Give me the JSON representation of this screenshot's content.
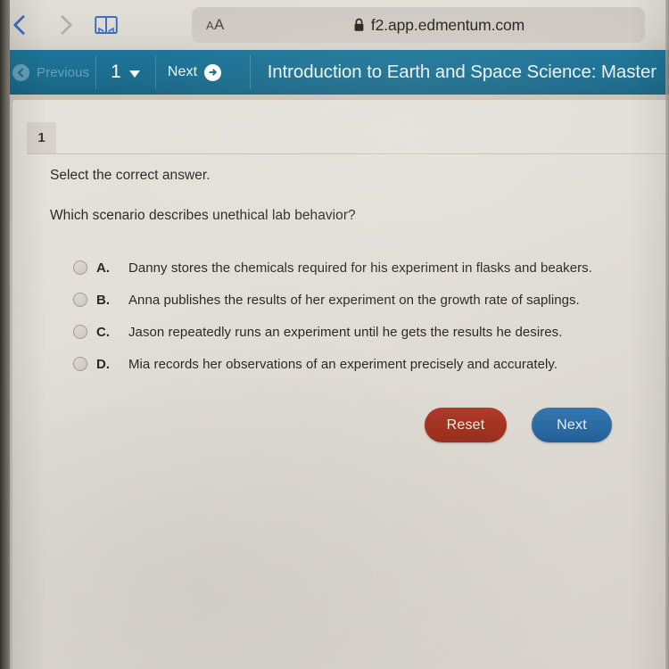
{
  "browser": {
    "back_icon": "chevron-left-icon",
    "forward_icon": "chevron-right-icon",
    "bookmarks_icon": "book-icon",
    "text_size_label": "AA",
    "lock_icon": "lock-icon",
    "url": "f2.app.edmentum.com"
  },
  "navbar": {
    "previous_label": "Previous",
    "previous_icon": "arrow-left-circle-icon",
    "page_number": "1",
    "page_dropdown_icon": "chevron-down-icon",
    "next_label": "Next",
    "next_icon": "arrow-right-circle-icon",
    "course_title": "Introduction to Earth and Space Science: Master",
    "accent_color": "#1a6c8e"
  },
  "question": {
    "tab_number": "1",
    "prompt": "Select the correct answer.",
    "text": "Which scenario describes unethical lab behavior?",
    "options": [
      {
        "letter": "A.",
        "text": "Danny stores the chemicals required for his experiment in flasks and beakers.",
        "selected": false
      },
      {
        "letter": "B.",
        "text": "Anna publishes the results of her experiment on the growth rate of saplings.",
        "selected": false
      },
      {
        "letter": "C.",
        "text": "Jason repeatedly runs an experiment until he gets the results he desires.",
        "selected": false
      },
      {
        "letter": "D.",
        "text": "Mia records her observations of an experiment precisely and accurately.",
        "selected": false
      }
    ]
  },
  "actions": {
    "reset_label": "Reset",
    "reset_color": "#a4321f",
    "next_label": "Next",
    "next_color": "#2a6ba4"
  }
}
